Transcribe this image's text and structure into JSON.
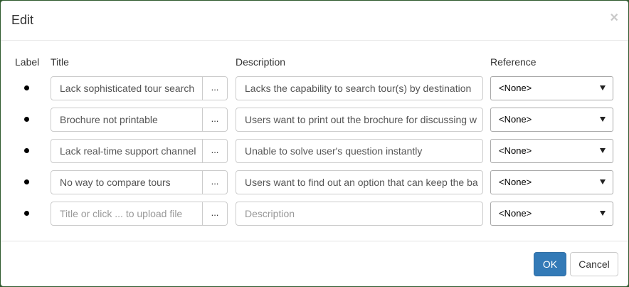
{
  "dialog": {
    "title": "Edit",
    "close_glyph": "×"
  },
  "columns": {
    "label": "Label",
    "title": "Title",
    "description": "Description",
    "reference": "Reference"
  },
  "rows": [
    {
      "title": "Lack sophisticated tour search",
      "browse_label": "...",
      "description": "Lacks the capability to search tour(s) by destination",
      "reference": "<None>"
    },
    {
      "title": "Brochure not printable",
      "browse_label": "...",
      "description": "Users want to print out the brochure for discussing w",
      "reference": "<None>"
    },
    {
      "title": "Lack real-time support channel",
      "browse_label": "...",
      "description": "Unable to solve user's question instantly",
      "reference": "<None>"
    },
    {
      "title": "No way to compare tours",
      "browse_label": "...",
      "description": "Users want to find out an option that can keep the ba",
      "reference": "<None>"
    }
  ],
  "new_row": {
    "title_placeholder": "Title or click ... to upload file",
    "browse_label": "...",
    "description_placeholder": "Description",
    "reference": "<None>"
  },
  "footer": {
    "ok_label": "OK",
    "cancel_label": "Cancel"
  },
  "colors": {
    "primary": "#337ab7",
    "backdrop": "#2f5a2e"
  },
  "icons": {
    "bullet": "bullet-icon",
    "dropdown": "chevron-down-icon",
    "close": "close-icon"
  }
}
